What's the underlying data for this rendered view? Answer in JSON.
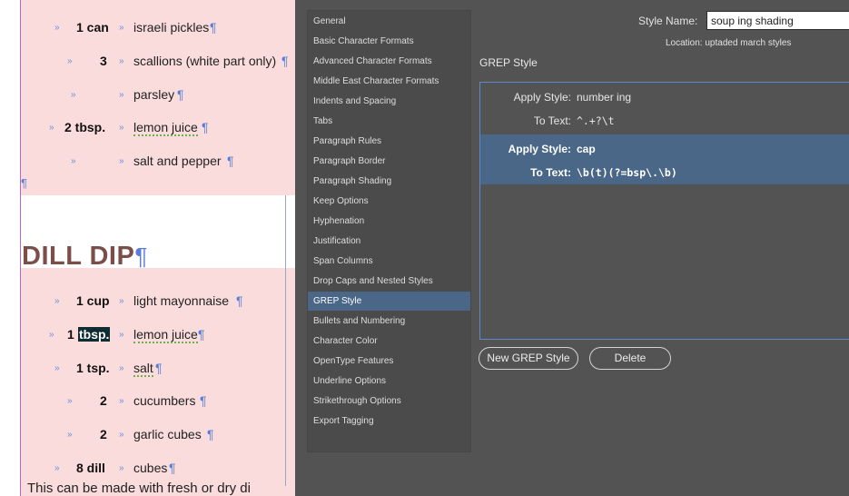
{
  "document": {
    "top_ingredients": [
      {
        "qty": "1 can",
        "item": "israeli pickles"
      },
      {
        "qty": "3",
        "item": "scallions (white part only)"
      },
      {
        "qty": "",
        "item": "parsley"
      },
      {
        "qty": "2 tbsp.",
        "item": "lemon juice"
      },
      {
        "qty": "",
        "item": "salt and pepper"
      }
    ],
    "section_title": "DILL DIP",
    "dip_ingredients": [
      {
        "qty": "1 cup",
        "item": "light mayonnaise"
      },
      {
        "qty_num": "1",
        "qty_unit": "tbsp.",
        "item": "lemon juice"
      },
      {
        "qty": "1 tsp.",
        "item": "salt"
      },
      {
        "qty": "2",
        "item": "cucumbers"
      },
      {
        "qty": "2",
        "item": "garlic cubes"
      },
      {
        "qty": "8 dill",
        "item": "cubes"
      }
    ],
    "footer_text": "This can be made with fresh or dry di",
    "pilcrow": "¶",
    "tab_glyph": "»"
  },
  "dialog": {
    "categories": [
      "General",
      "Basic Character Formats",
      "Advanced Character Formats",
      "Middle East Character Formats",
      "Indents and Spacing",
      "Tabs",
      "Paragraph Rules",
      "Paragraph Border",
      "Paragraph Shading",
      "Keep Options",
      "Hyphenation",
      "Justification",
      "Span Columns",
      "Drop Caps and Nested Styles",
      "GREP Style",
      "Bullets and Numbering",
      "Character Color",
      "OpenType Features",
      "Underline Options",
      "Strikethrough Options",
      "Export Tagging"
    ],
    "selected_category": "GREP Style",
    "style_name_label": "Style Name:",
    "style_name_value": "soup ing shading",
    "location": "Location: uptaded march styles",
    "section_title": "GREP Style",
    "grep_rules": [
      {
        "apply_label": "Apply Style:",
        "apply_value": "number ing",
        "text_label": "To Text:",
        "text_value": "^.+?\\t"
      },
      {
        "apply_label": "Apply Style:",
        "apply_value": "cap",
        "text_label": "To Text:",
        "text_value": "\\b(t)(?=bsp\\.\\b)"
      }
    ],
    "new_button": "New GREP Style",
    "delete_button": "Delete",
    "colors": {
      "panel": "#535353",
      "selection": "#4a6788",
      "list_bg": "#4b4b4b",
      "doc_frame": "#f9dcdb",
      "title": "#7a4f4a"
    }
  }
}
